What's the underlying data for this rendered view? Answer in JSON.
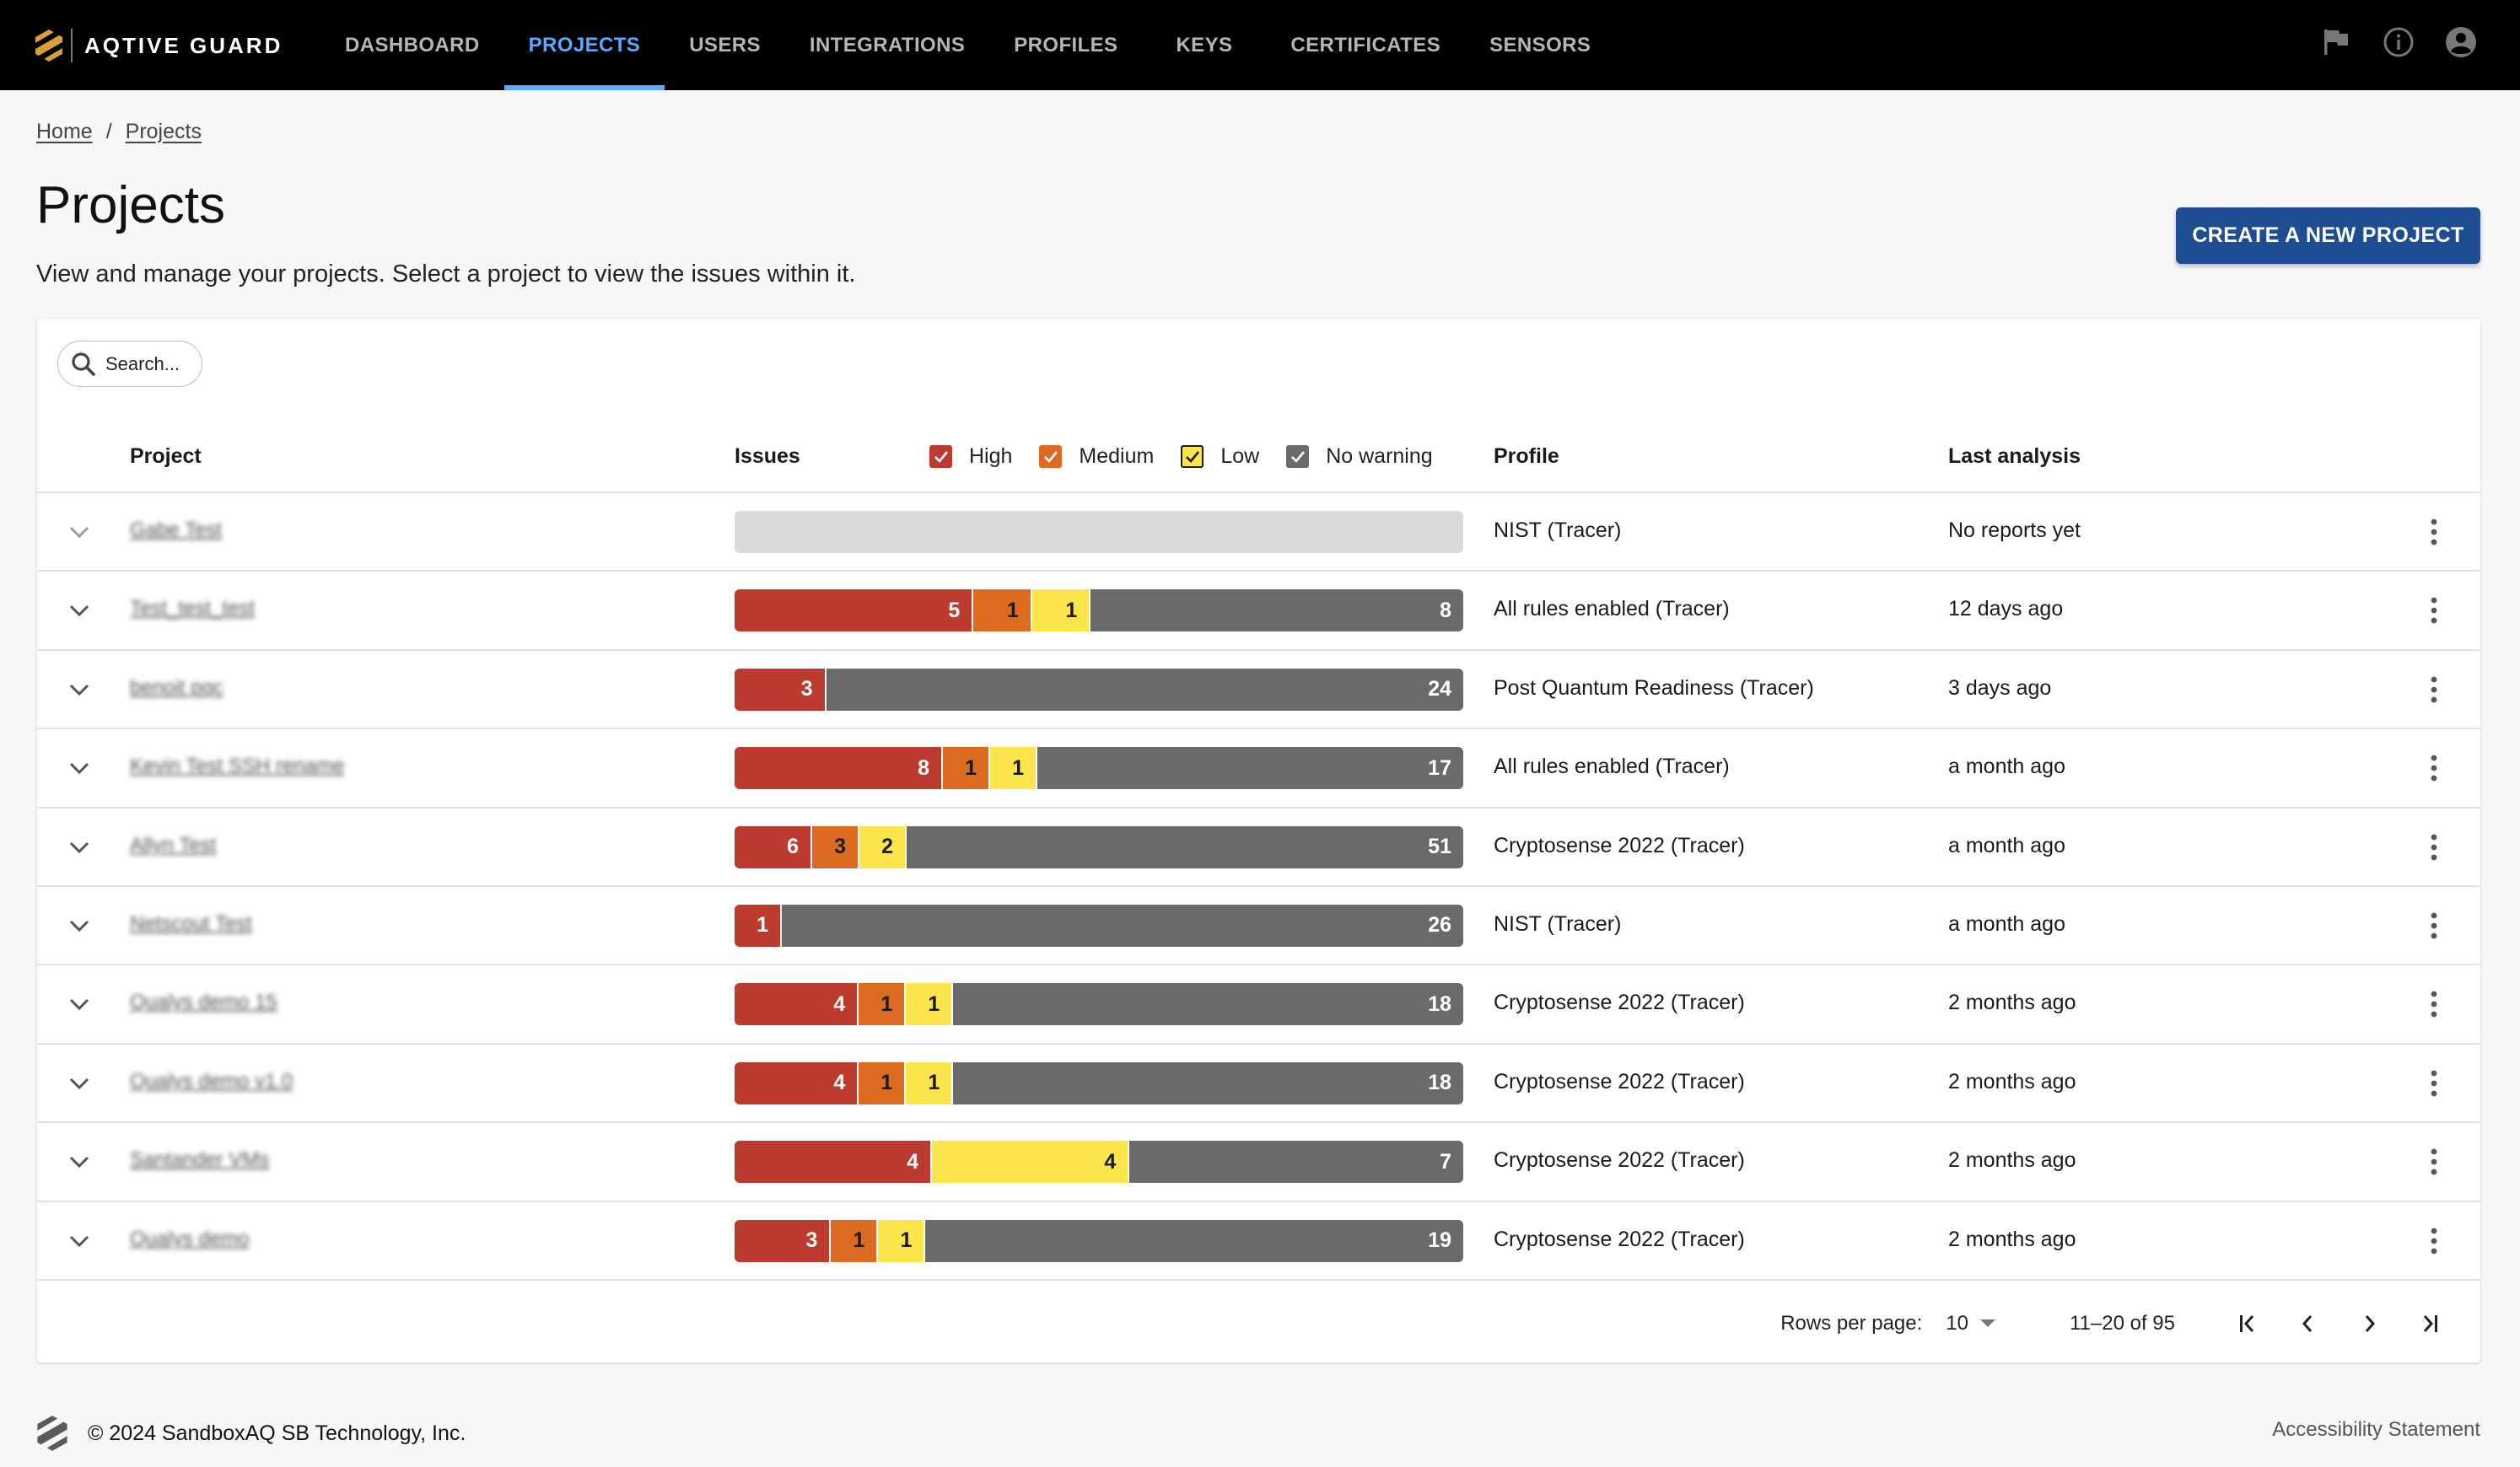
{
  "app": {
    "brand": "AQTIVE GUARD",
    "nav": [
      {
        "label": "DASHBOARD",
        "active": false
      },
      {
        "label": "PROJECTS",
        "active": true
      },
      {
        "label": "USERS",
        "active": false
      },
      {
        "label": "INTEGRATIONS",
        "active": false
      },
      {
        "label": "PROFILES",
        "active": false
      },
      {
        "label": "KEYS",
        "active": false
      },
      {
        "label": "CERTIFICATES",
        "active": false
      },
      {
        "label": "SENSORS",
        "active": false
      }
    ],
    "top_icons": [
      "flag-icon",
      "info-icon",
      "account-icon"
    ]
  },
  "breadcrumb": [
    {
      "label": "Home"
    },
    {
      "label": "Projects"
    }
  ],
  "breadcrumb_separator": "/",
  "page": {
    "title": "Projects",
    "subtitle": "View and manage your projects. Select a project to view the issues within it.",
    "create_button": "CREATE A NEW PROJECT"
  },
  "search": {
    "placeholder": "Search...",
    "value": ""
  },
  "table": {
    "columns": {
      "project": "Project",
      "issues": "Issues",
      "profile": "Profile",
      "last_analysis": "Last analysis"
    },
    "legend": [
      {
        "key": "high",
        "label": "High",
        "color": "#bd3a2f",
        "checked": true,
        "check_color": "#ffffff"
      },
      {
        "key": "medium",
        "label": "Medium",
        "color": "#dc6a21",
        "checked": true,
        "check_color": "#ffffff"
      },
      {
        "key": "low",
        "label": "Low",
        "color": "#fbe54a",
        "checked": true,
        "check_color": "#1a1a1a"
      },
      {
        "key": "none",
        "label": "No warning",
        "color": "#6a6a6a",
        "checked": true,
        "check_color": "#ffffff"
      }
    ],
    "empty_bar_color": "#dadada",
    "rows": [
      {
        "name": "Gabe Test",
        "issues": null,
        "profile": "NIST (Tracer)",
        "last_analysis": "No reports yet"
      },
      {
        "name": "Test_test_test",
        "issues": {
          "high": 5,
          "medium": 1,
          "low": 1,
          "none": 8
        },
        "profile": "All rules enabled (Tracer)",
        "last_analysis": "12 days ago"
      },
      {
        "name": "benoit pqc",
        "issues": {
          "high": 3,
          "medium": 0,
          "low": 0,
          "none": 24
        },
        "profile": "Post Quantum Readiness (Tracer)",
        "last_analysis": "3 days ago"
      },
      {
        "name": "Kevin Test SSH rename",
        "issues": {
          "high": 8,
          "medium": 1,
          "low": 1,
          "none": 17
        },
        "profile": "All rules enabled (Tracer)",
        "last_analysis": "a month ago"
      },
      {
        "name": "Allyn Test",
        "issues": {
          "high": 6,
          "medium": 3,
          "low": 2,
          "none": 51
        },
        "profile": "Cryptosense 2022 (Tracer)",
        "last_analysis": "a month ago"
      },
      {
        "name": "Netscout Test",
        "issues": {
          "high": 1,
          "medium": 0,
          "low": 0,
          "none": 26
        },
        "profile": "NIST (Tracer)",
        "last_analysis": "a month ago"
      },
      {
        "name": "Qualys demo 15",
        "issues": {
          "high": 4,
          "medium": 1,
          "low": 1,
          "none": 18
        },
        "profile": "Cryptosense 2022 (Tracer)",
        "last_analysis": "2 months ago"
      },
      {
        "name": "Qualys demo v1.0",
        "issues": {
          "high": 4,
          "medium": 1,
          "low": 1,
          "none": 18
        },
        "profile": "Cryptosense 2022 (Tracer)",
        "last_analysis": "2 months ago"
      },
      {
        "name": "Santander VMs",
        "issues": {
          "high": 4,
          "medium": 0,
          "low": 4,
          "none": 7
        },
        "profile": "Cryptosense 2022 (Tracer)",
        "last_analysis": "2 months ago"
      },
      {
        "name": "Qualys demo",
        "issues": {
          "high": 3,
          "medium": 1,
          "low": 1,
          "none": 19
        },
        "profile": "Cryptosense 2022 (Tracer)",
        "last_analysis": "2 months ago"
      }
    ]
  },
  "pagination": {
    "rows_per_page_label": "Rows per page:",
    "rows_per_page": "10",
    "range": "11–20 of 95"
  },
  "footer": {
    "copyright": "© 2024 SandboxAQ SB Technology, Inc.",
    "accessibility": "Accessibility Statement"
  },
  "colors": {
    "topbar": "#000000",
    "accent_nav": "#5aa9ff",
    "primary_button": "#1f4d92",
    "logo_gold": "#d9a032"
  }
}
